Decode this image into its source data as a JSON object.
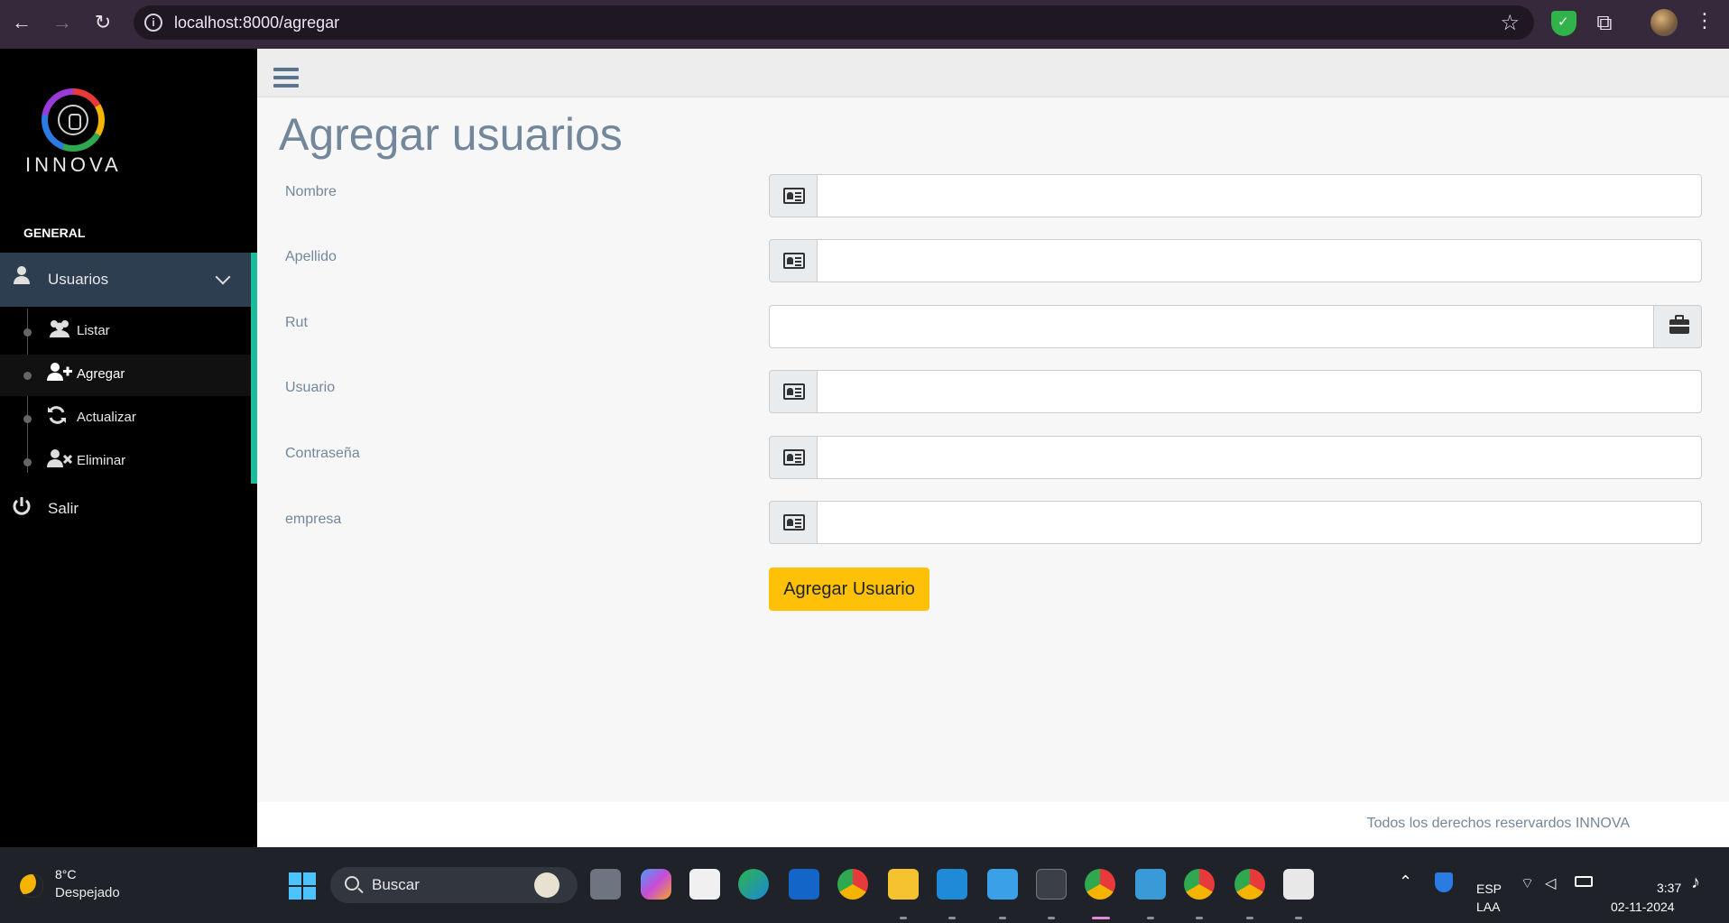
{
  "browser": {
    "url": "localhost:8000/agregar"
  },
  "sidebar": {
    "logo_text": "INNOVA",
    "section_label": "GENERAL",
    "menu": {
      "label": "Usuarios",
      "items": [
        {
          "label": "Listar"
        },
        {
          "label": "Agregar"
        },
        {
          "label": "Actualizar"
        },
        {
          "label": "Eliminar"
        }
      ]
    },
    "logout_label": "Salir"
  },
  "main": {
    "title": "Agregar usuarios",
    "fields": [
      {
        "label": "Nombre",
        "value": ""
      },
      {
        "label": "Apellido",
        "value": ""
      },
      {
        "label": "Rut",
        "value": ""
      },
      {
        "label": "Usuario",
        "value": ""
      },
      {
        "label": "Contraseña",
        "value": ""
      },
      {
        "label": "empresa",
        "value": ""
      }
    ],
    "submit_label": "Agregar Usuario",
    "footer_text": "Todos los derechos reservardos INNOVA"
  },
  "taskbar": {
    "weather_temp": "8°C",
    "weather_desc": "Despejado",
    "search_placeholder": "Buscar",
    "lang_top": "ESP",
    "lang_bottom": "LAA",
    "time": "3:37",
    "date": "02-11-2024"
  },
  "colors": {
    "accent": "#1abc9c",
    "button": "#ffc107",
    "text_muted": "#73879c"
  }
}
